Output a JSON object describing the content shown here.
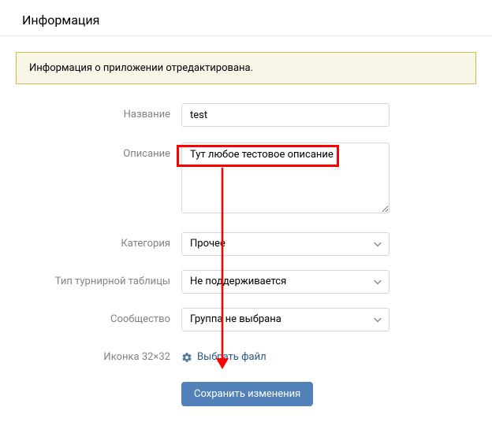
{
  "header": {
    "title": "Информация"
  },
  "notice": {
    "text": "Информация о приложении отредактирована."
  },
  "form": {
    "name": {
      "label": "Название",
      "value": "test"
    },
    "description": {
      "label": "Описание",
      "value": "Тут любое тестовое описание"
    },
    "category": {
      "label": "Категория",
      "selected": "Прочее"
    },
    "tournament": {
      "label": "Тип турнирной таблицы",
      "selected": "Не поддерживается"
    },
    "community": {
      "label": "Сообщество",
      "selected": "Группа не выбрана"
    },
    "icon": {
      "label": "Иконка 32×32",
      "link": "Выбрать файл"
    }
  },
  "actions": {
    "save": "Сохранить изменения"
  }
}
